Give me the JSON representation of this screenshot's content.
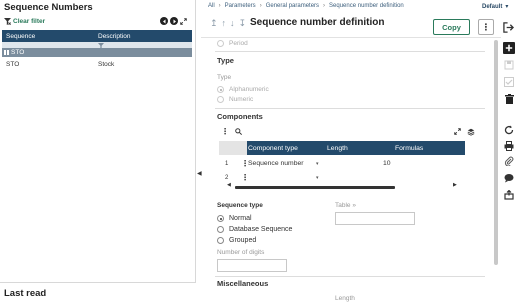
{
  "left_panel": {
    "title": "Sequence Numbers",
    "clear_filter": "Clear filter",
    "columns": [
      "Sequence",
      "Description"
    ],
    "rows": [
      {
        "sequence": "STO",
        "description": "",
        "selected": true
      },
      {
        "sequence": "STO",
        "description": "Stock",
        "selected": false
      }
    ],
    "footer_title": "Last read"
  },
  "header": {
    "breadcrumb": [
      "All",
      "Parameters",
      "General parameters",
      "Sequence number definition"
    ],
    "default_label": "Default",
    "title": "Sequence number definition",
    "copy_label": "Copy"
  },
  "form": {
    "period_label": "Period",
    "type_section": "Type",
    "type_field_label": "Type",
    "type_options": [
      {
        "label": "Alphanumeric",
        "selected": true
      },
      {
        "label": "Numeric",
        "selected": false
      }
    ],
    "components_section": "Components",
    "components_columns": [
      "Component type",
      "Length",
      "Formulas"
    ],
    "components_rows": [
      {
        "num": "1",
        "type": "Sequence number",
        "length": "10",
        "formula": ""
      },
      {
        "num": "2",
        "type": "",
        "length": "",
        "formula": ""
      }
    ],
    "sequence_type_label": "Sequence type",
    "sequence_type_options": [
      {
        "label": "Normal",
        "selected": true
      },
      {
        "label": "Database Sequence",
        "selected": false
      },
      {
        "label": "Grouped",
        "selected": false
      }
    ],
    "table_label": "Table",
    "table_value": "",
    "number_of_digits_label": "Number of digits",
    "number_of_digits_value": "",
    "misc_section": "Miscellaneous",
    "length_label": "Length"
  },
  "colors": {
    "accent": "#2a7a5b",
    "grid_header": "#234a6b",
    "selected_row": "#7b8d9d"
  }
}
